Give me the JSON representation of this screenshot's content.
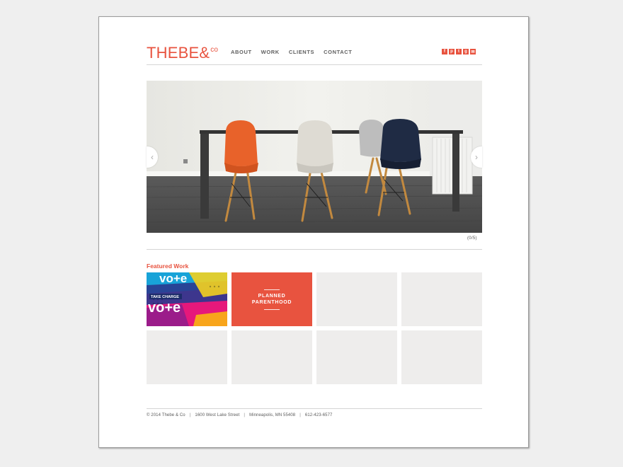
{
  "brand": {
    "logo_main": "THEBE&",
    "logo_sup": "co",
    "accent_color": "#e8533f"
  },
  "nav": {
    "items": [
      {
        "label": "ABOUT"
      },
      {
        "label": "WORK"
      },
      {
        "label": "CLIENTS"
      },
      {
        "label": "CONTACT"
      }
    ]
  },
  "social": {
    "icons": [
      {
        "glyph": "f",
        "name": "facebook"
      },
      {
        "glyph": "p",
        "name": "pinterest"
      },
      {
        "glyph": "t",
        "name": "twitter"
      },
      {
        "glyph": "g",
        "name": "google-plus"
      },
      {
        "glyph": "✉",
        "name": "email"
      }
    ]
  },
  "slider": {
    "prev_glyph": "‹",
    "next_glyph": "›",
    "counter": "(0/5)"
  },
  "featured": {
    "title": "Featured Work",
    "tiles": [
      {
        "type": "vote",
        "line1": "vo+e",
        "middle": "TAKE CHARGE",
        "line2": "vo+e"
      },
      {
        "type": "planned",
        "label_line1": "PLANNED",
        "label_line2": "PARENTHOOD"
      },
      {
        "type": "empty"
      },
      {
        "type": "empty"
      },
      {
        "type": "empty"
      },
      {
        "type": "empty"
      },
      {
        "type": "empty"
      },
      {
        "type": "empty"
      }
    ]
  },
  "footer": {
    "copyright": "© 2014 Thebe & Co",
    "address": "1600 West Lake Street",
    "city": "Minneapolis, MN 55408",
    "phone": "612-423-6577"
  }
}
